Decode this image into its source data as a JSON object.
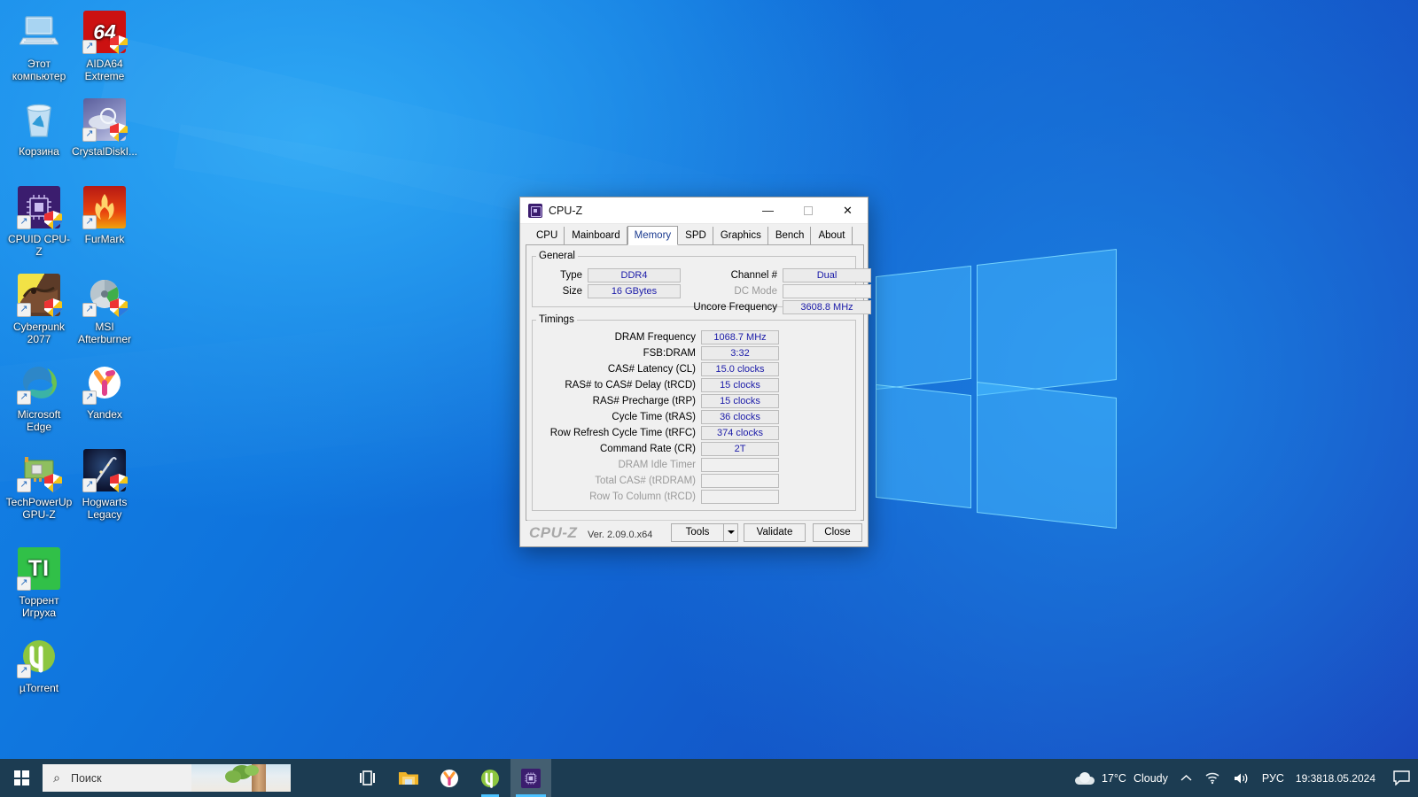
{
  "desktop": {
    "icons": [
      {
        "label": "Этот компьютер",
        "icon": "this-pc-icon",
        "shortcut": false,
        "shield": false
      },
      {
        "label": "AIDA64 Extreme",
        "icon": "aida64-icon",
        "shortcut": true,
        "shield": true
      },
      {
        "label": "Корзина",
        "icon": "recycle-bin-icon",
        "shortcut": false,
        "shield": false
      },
      {
        "label": "CrystalDiskI...",
        "icon": "crystaldiskinfo-icon",
        "shortcut": true,
        "shield": true
      },
      {
        "label": "CPUID CPU-Z",
        "icon": "cpuz-icon",
        "shortcut": true,
        "shield": true
      },
      {
        "label": "FurMark",
        "icon": "furmark-icon",
        "shortcut": true,
        "shield": false
      },
      {
        "label": "Cyberpunk 2077",
        "icon": "cyberpunk2077-icon",
        "shortcut": true,
        "shield": true
      },
      {
        "label": "MSI Afterburner",
        "icon": "msi-afterburner-icon",
        "shortcut": true,
        "shield": true
      },
      {
        "label": "Microsoft Edge",
        "icon": "microsoft-edge-icon",
        "shortcut": true,
        "shield": false
      },
      {
        "label": "Yandex",
        "icon": "yandex-icon",
        "shortcut": true,
        "shield": false
      },
      {
        "label": "TechPowerUp GPU-Z",
        "icon": "gpuz-icon",
        "shortcut": true,
        "shield": true
      },
      {
        "label": "Hogwarts Legacy",
        "icon": "hogwarts-legacy-icon",
        "shortcut": true,
        "shield": true
      },
      {
        "label": "Торрент Игруха",
        "icon": "torrent-igruha-icon",
        "shortcut": true,
        "shield": false
      },
      {
        "label": "µTorrent",
        "icon": "utorrent-icon",
        "shortcut": true,
        "shield": false
      }
    ]
  },
  "window": {
    "title": "CPU-Z",
    "icon": "cpuz-app-icon",
    "buttons": {
      "minimize": "—",
      "maximize": "▢",
      "close": "✕"
    },
    "tabs": [
      {
        "label": "CPU",
        "active": false
      },
      {
        "label": "Mainboard",
        "active": false
      },
      {
        "label": "Memory",
        "active": true
      },
      {
        "label": "SPD",
        "active": false
      },
      {
        "label": "Graphics",
        "active": false
      },
      {
        "label": "Bench",
        "active": false
      },
      {
        "label": "About",
        "active": false
      }
    ],
    "general": {
      "legend": "General",
      "left_fields": [
        {
          "label": "Type",
          "value": "DDR4",
          "disabled": false
        },
        {
          "label": "Size",
          "value": "16 GBytes",
          "disabled": false
        }
      ],
      "right_fields": [
        {
          "label": "Channel #",
          "value": "Dual",
          "disabled": false
        },
        {
          "label": "DC Mode",
          "value": "",
          "disabled": true
        },
        {
          "label": "Uncore Frequency",
          "value": "3608.8 MHz",
          "disabled": false
        }
      ]
    },
    "timings": {
      "legend": "Timings",
      "fields": [
        {
          "label": "DRAM Frequency",
          "value": "1068.7 MHz",
          "disabled": false
        },
        {
          "label": "FSB:DRAM",
          "value": "3:32",
          "disabled": false
        },
        {
          "label": "CAS# Latency (CL)",
          "value": "15.0 clocks",
          "disabled": false
        },
        {
          "label": "RAS# to CAS# Delay (tRCD)",
          "value": "15 clocks",
          "disabled": false
        },
        {
          "label": "RAS# Precharge (tRP)",
          "value": "15 clocks",
          "disabled": false
        },
        {
          "label": "Cycle Time (tRAS)",
          "value": "36 clocks",
          "disabled": false
        },
        {
          "label": "Row Refresh Cycle Time (tRFC)",
          "value": "374 clocks",
          "disabled": false
        },
        {
          "label": "Command Rate (CR)",
          "value": "2T",
          "disabled": false
        },
        {
          "label": "DRAM Idle Timer",
          "value": "",
          "disabled": true
        },
        {
          "label": "Total CAS# (tRDRAM)",
          "value": "",
          "disabled": true
        },
        {
          "label": "Row To Column (tRCD)",
          "value": "",
          "disabled": true
        }
      ]
    },
    "footer": {
      "brand": "CPU-Z",
      "version": "Ver. 2.09.0.x64",
      "tools_label": "Tools",
      "validate_label": "Validate",
      "close_label": "Close"
    }
  },
  "taskbar": {
    "start_icon": "windows-start-icon",
    "search": {
      "placeholder": "Поиск",
      "icon": "search-icon"
    },
    "buttons": [
      {
        "name": "task-view",
        "icon": "task-view-icon",
        "state": "idle"
      },
      {
        "name": "file-explorer",
        "icon": "file-explorer-icon",
        "state": "idle"
      },
      {
        "name": "yandex-browser",
        "icon": "yandex-icon",
        "state": "idle"
      },
      {
        "name": "utorrent",
        "icon": "utorrent-icon",
        "state": "running"
      },
      {
        "name": "cpuz",
        "icon": "cpuz-icon",
        "state": "active"
      }
    ],
    "tray": {
      "weather_temp": "17°C",
      "weather_text": "Cloudy",
      "weather_icon": "cloud-icon",
      "chevron": "⌃",
      "network_icon": "wifi-icon",
      "volume_icon": "speaker-icon",
      "language": "РУС",
      "time": "19:38",
      "date": "18.05.2024",
      "notification_icon": "notification-icon"
    }
  },
  "colors": {
    "accent": "#0078d7",
    "taskbar": "#1c3c52",
    "value_text": "#1a1aa8",
    "desktop_blue": "#0b66d4"
  }
}
